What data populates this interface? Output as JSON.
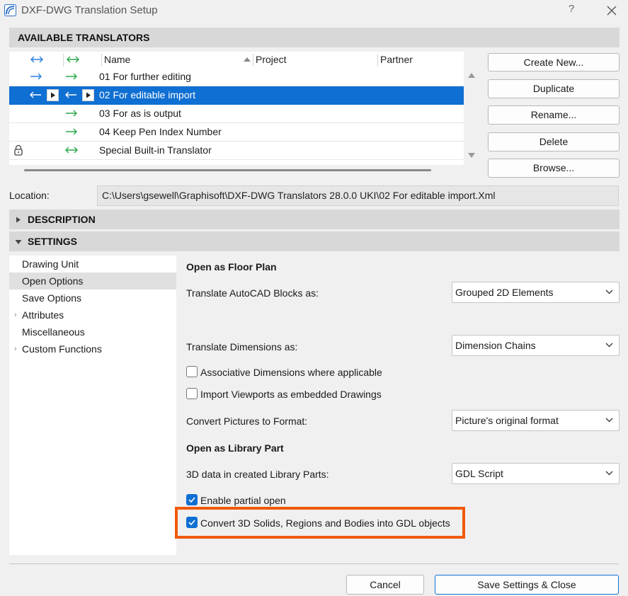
{
  "window": {
    "title": "DXF-DWG Translation Setup",
    "help_label": "?"
  },
  "translators": {
    "section_title": "AVAILABLE TRANSLATORS",
    "columns": {
      "name": "Name",
      "project": "Project",
      "partner": "Partner"
    },
    "rows": [
      {
        "name": "01 For further editing"
      },
      {
        "name": "02 For editable import",
        "selected": true
      },
      {
        "name": "03 For as is output"
      },
      {
        "name": "04 Keep Pen Index Number"
      },
      {
        "name": "Special Built-in Translator"
      }
    ]
  },
  "buttons": {
    "create_new": "Create New...",
    "duplicate": "Duplicate",
    "rename": "Rename...",
    "delete": "Delete",
    "browse": "Browse..."
  },
  "location": {
    "label": "Location:",
    "value": "C:\\Users\\gsewell\\Graphisoft\\DXF-DWG Translators 28.0.0 UKI\\02 For editable import.Xml"
  },
  "description": {
    "section_title": "DESCRIPTION"
  },
  "settings": {
    "section_title": "SETTINGS",
    "nav": [
      {
        "label": "Drawing Unit"
      },
      {
        "label": "Open Options"
      },
      {
        "label": "Save Options"
      },
      {
        "label": "Attributes"
      },
      {
        "label": "Miscellaneous"
      },
      {
        "label": "Custom Functions"
      }
    ],
    "open_floor_plan": {
      "title": "Open as Floor Plan",
      "blocks_label": "Translate AutoCAD Blocks as:",
      "blocks_value": "Grouped 2D Elements",
      "dimensions_label": "Translate Dimensions as:",
      "dimensions_value": "Dimension Chains",
      "assoc_dims_label": "Associative Dimensions where applicable",
      "assoc_dims_checked": false,
      "viewports_label": "Import Viewports as embedded Drawings",
      "viewports_checked": false,
      "pictures_label": "Convert Pictures to Format:",
      "pictures_value": "Picture's original format"
    },
    "open_library_part": {
      "title": "Open as Library Part",
      "data3d_label": "3D data in created Library Parts:",
      "data3d_value": "GDL Script",
      "partial_open_label": "Enable partial open",
      "partial_open_checked": true,
      "convert_solids_label": "Convert 3D Solids, Regions and Bodies into GDL objects",
      "convert_solids_checked": true
    }
  },
  "footer": {
    "cancel": "Cancel",
    "save_close": "Save Settings & Close"
  },
  "colors": {
    "selection": "#0f6fd2",
    "highlight_box": "#f05a0a",
    "arrow_blue": "#2a7fe0",
    "arrow_green": "#2aa84a"
  }
}
